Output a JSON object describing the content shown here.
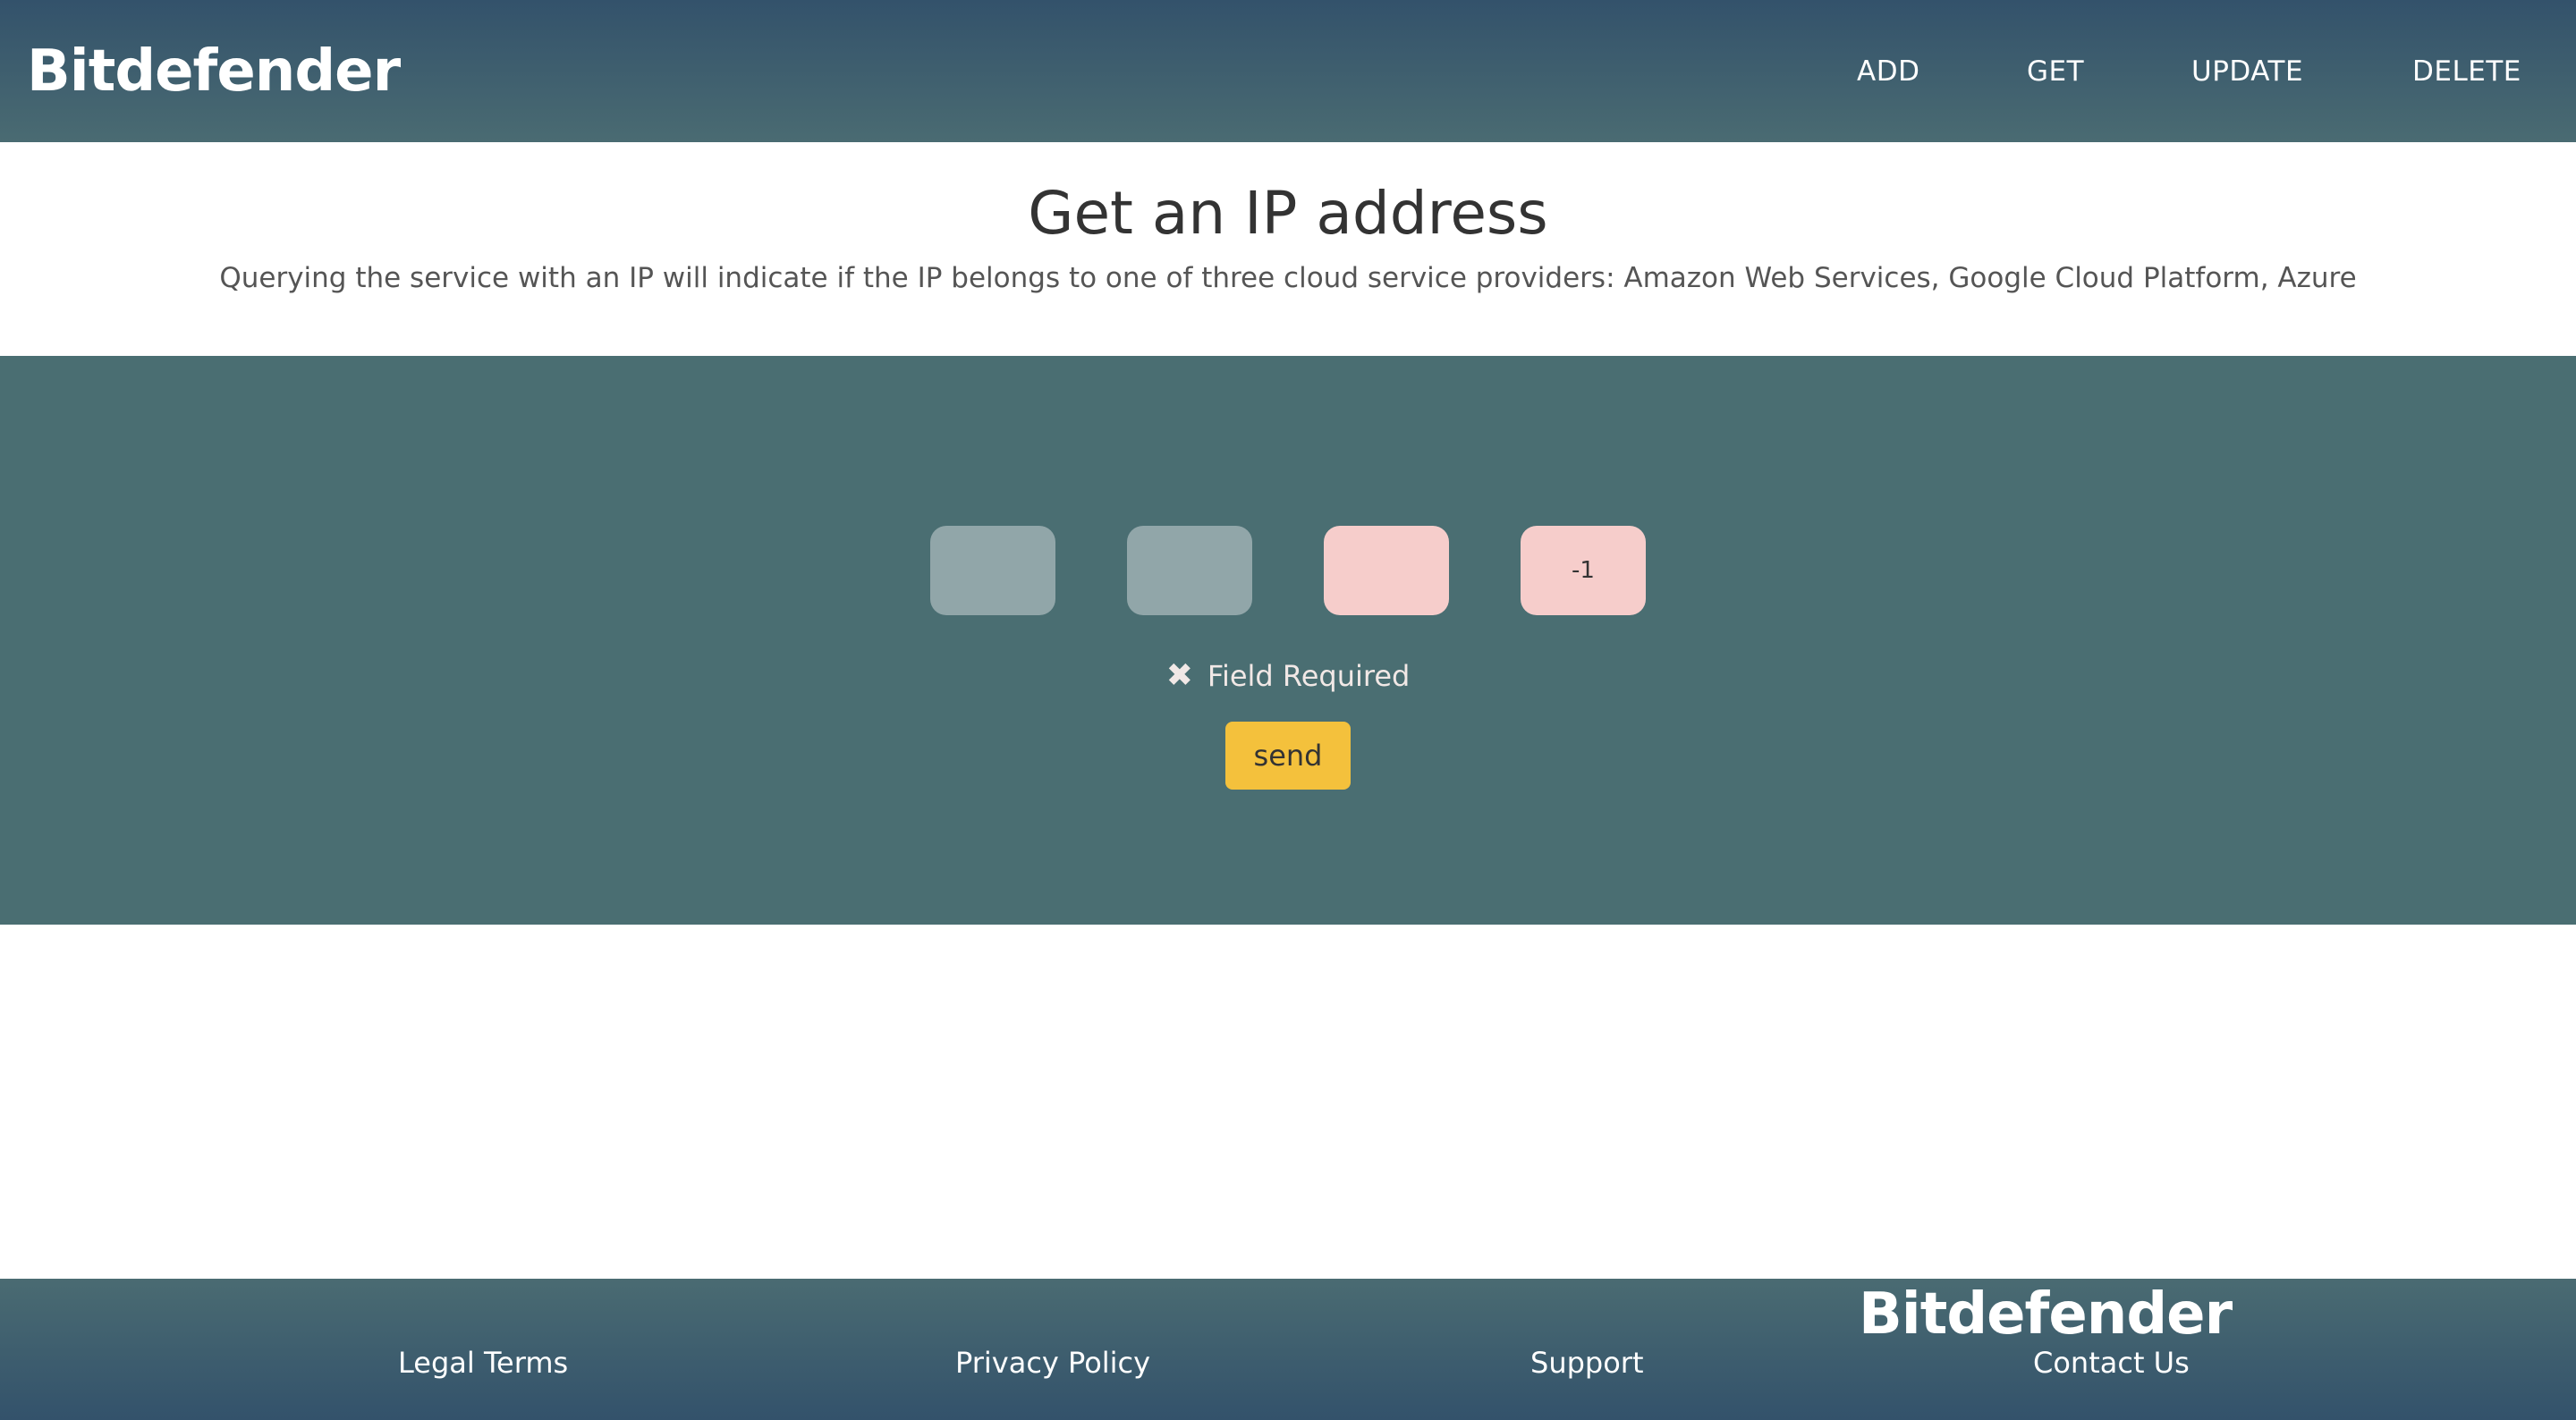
{
  "header": {
    "brand": "Bitdefender",
    "nav": [
      {
        "label": "ADD"
      },
      {
        "label": "GET"
      },
      {
        "label": "UPDATE"
      },
      {
        "label": "DELETE"
      }
    ]
  },
  "main": {
    "title": "Get an IP address",
    "subtitle": "Querying the service with an IP will indicate if the IP belongs to one of three cloud service providers: Amazon Web Services, Google Cloud Platform, Azure"
  },
  "form": {
    "octets": [
      {
        "value": "",
        "state": "valid"
      },
      {
        "value": "",
        "state": "valid"
      },
      {
        "value": "",
        "state": "error"
      },
      {
        "value": "-1",
        "state": "error"
      }
    ],
    "error_icon": "close-x-icon",
    "error_glyph": "✖",
    "error_message": "Field Required",
    "send_label": "send"
  },
  "footer": {
    "brand": "Bitdefender",
    "links": [
      {
        "label": "Legal Terms"
      },
      {
        "label": "Privacy Policy"
      },
      {
        "label": "Support"
      },
      {
        "label": "Contact Us"
      }
    ]
  },
  "colors": {
    "header_top": "#33526b",
    "header_bottom": "#4a6b72",
    "panel": "#4a6e72",
    "input_valid": "#91a6a9",
    "input_error": "#f6cdcb",
    "button": "#f4c13c"
  }
}
